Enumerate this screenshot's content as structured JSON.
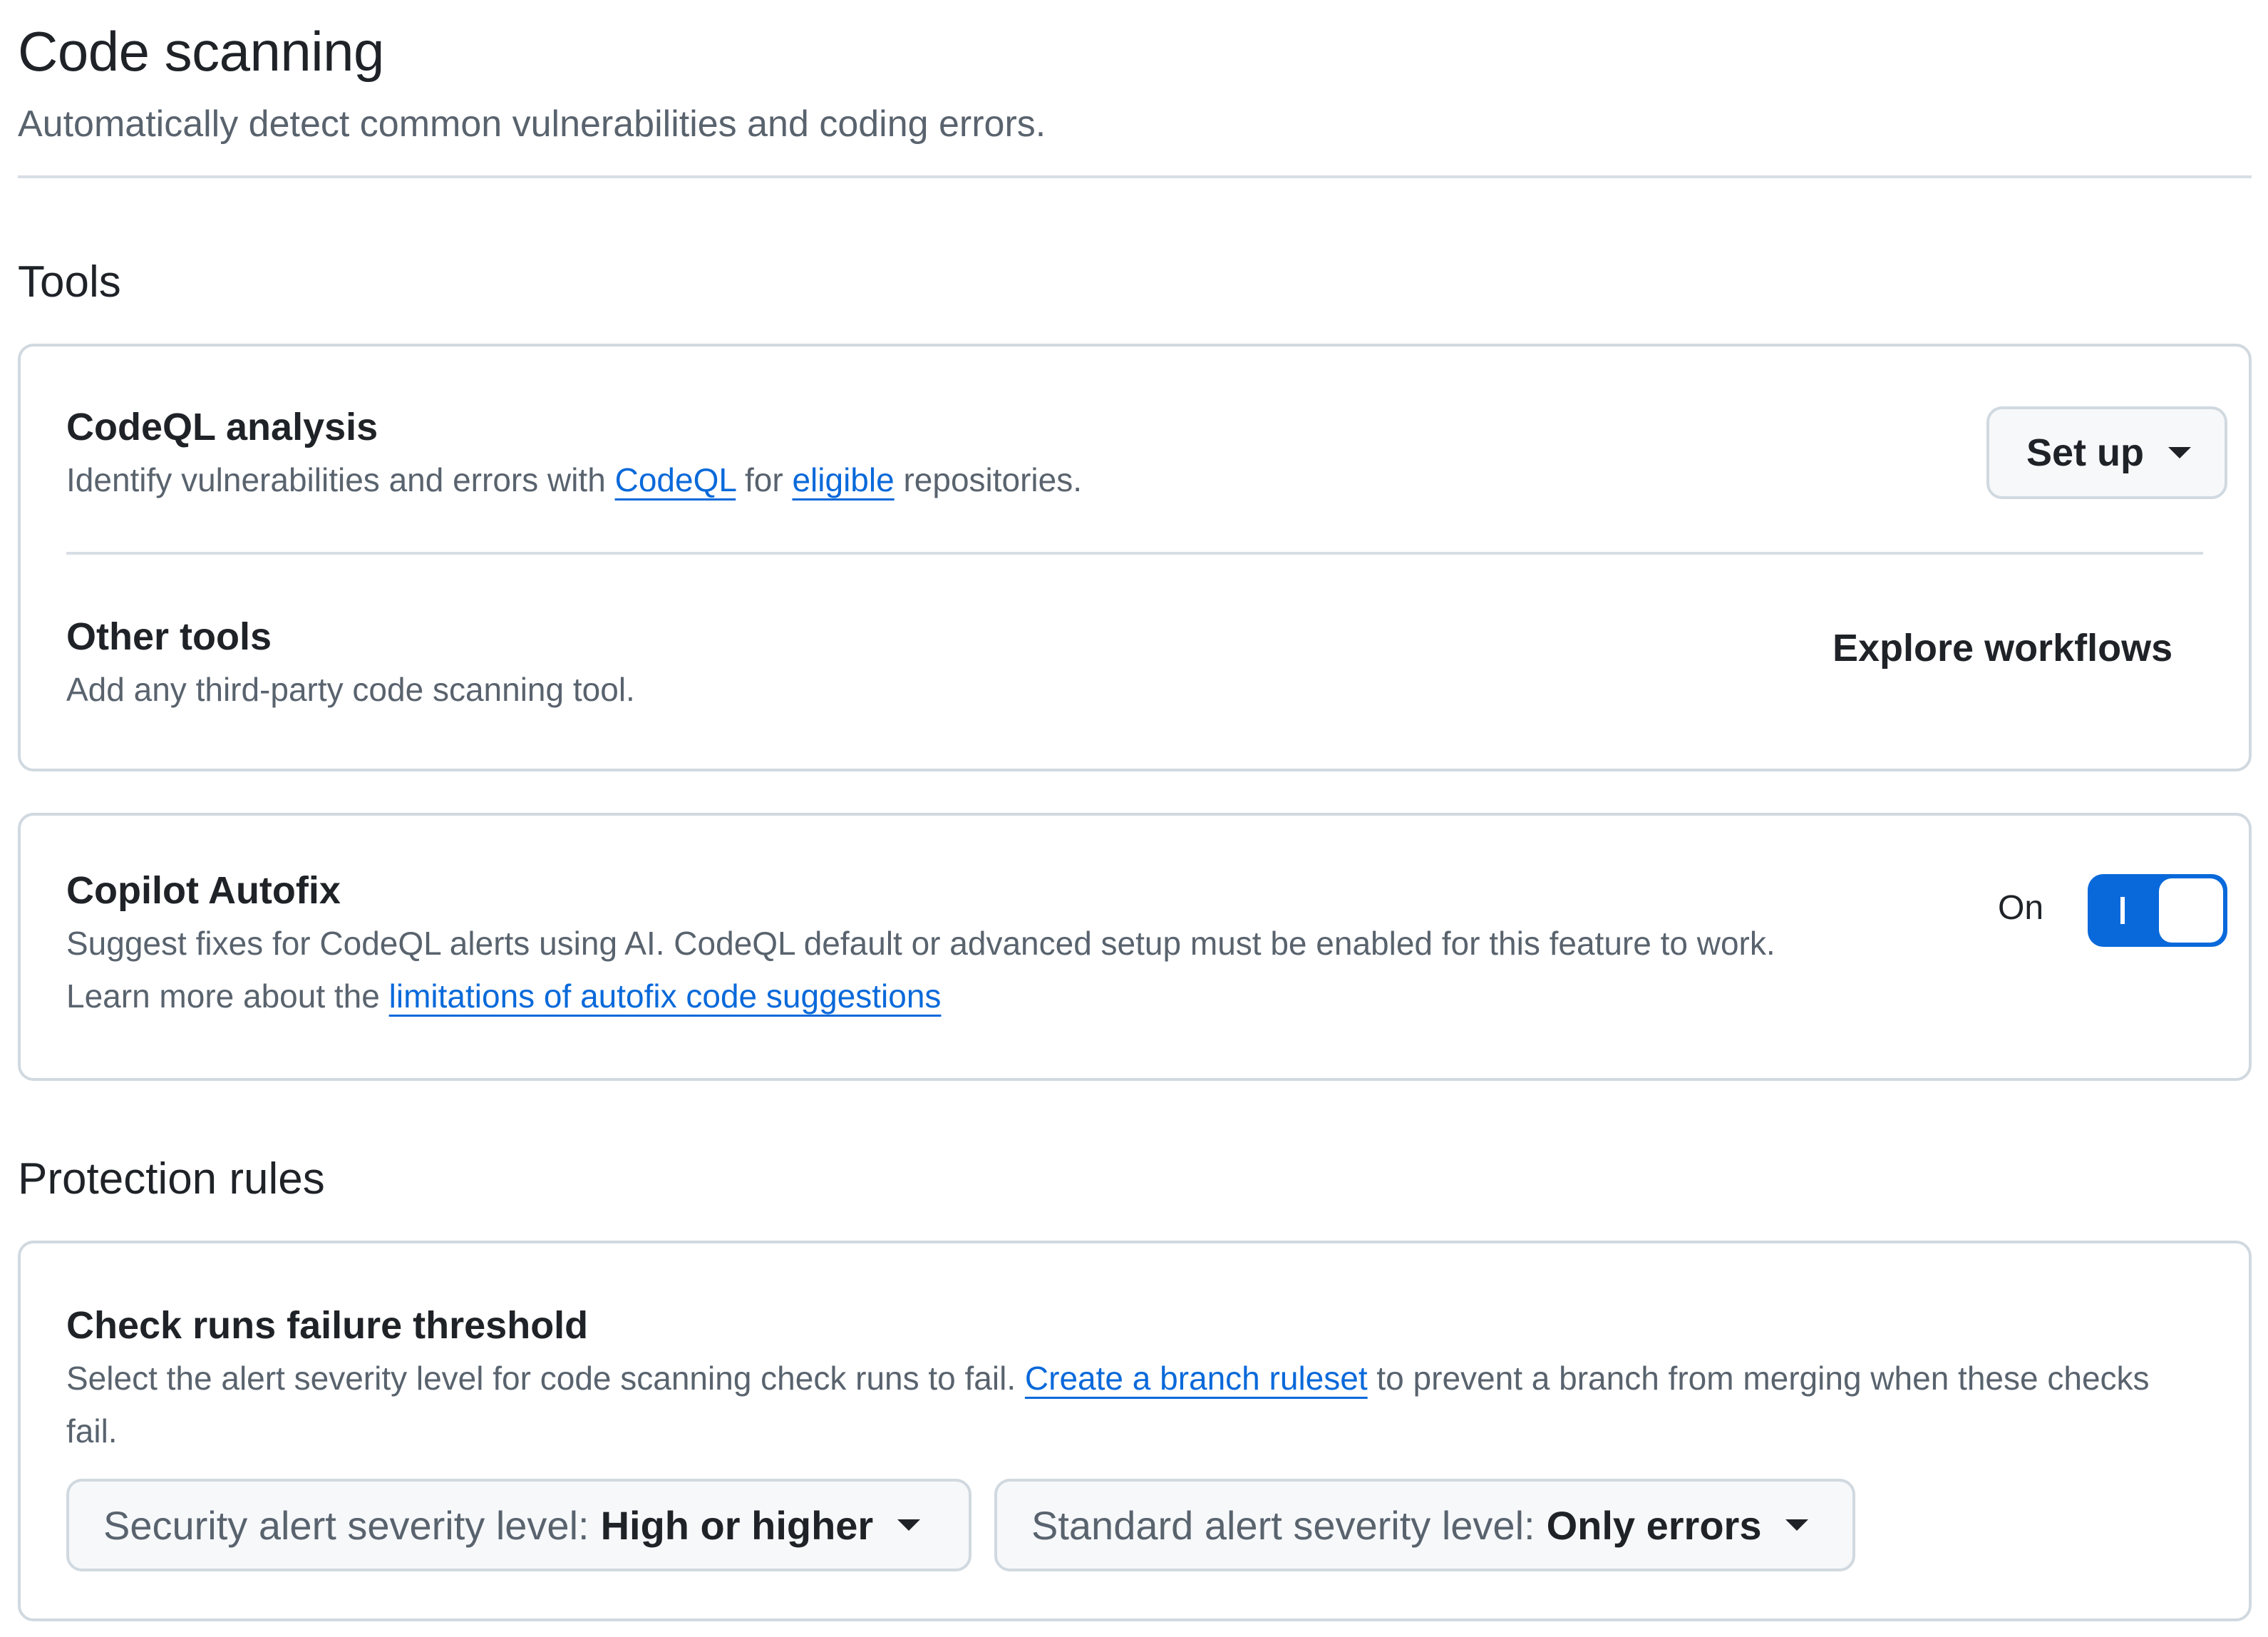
{
  "header": {
    "title": "Code scanning",
    "subtitle": "Automatically detect common vulnerabilities and coding errors."
  },
  "tools": {
    "title": "Tools",
    "codeql": {
      "title": "CodeQL analysis",
      "desc_prefix": "Identify vulnerabilities and errors with ",
      "link_codeql": "CodeQL",
      "desc_mid": " for ",
      "link_eligible": "eligible",
      "desc_suffix": " repositories.",
      "button": "Set up"
    },
    "other": {
      "title": "Other tools",
      "desc": "Add any third-party code scanning tool.",
      "button": "Explore workflows"
    }
  },
  "autofix": {
    "title": "Copilot Autofix",
    "desc_line1": "Suggest fixes for CodeQL alerts using AI. CodeQL default or advanced setup must be enabled for this feature to work.",
    "desc_line2_prefix": "Learn more about the ",
    "link": "limitations of autofix code suggestions",
    "toggle_label": "On",
    "toggle_state": "on"
  },
  "protection": {
    "title": "Protection rules",
    "threshold": {
      "title": "Check runs failure threshold",
      "desc_prefix": "Select the alert severity level for code scanning check runs to fail. ",
      "link": "Create a branch ruleset",
      "desc_suffix": " to prevent a branch from merging when these checks fail.",
      "security_label": "Security alert severity level:",
      "security_value": "High or higher",
      "standard_label": "Standard alert severity level:",
      "standard_value": "Only errors"
    }
  },
  "colors": {
    "accent": "#0969da",
    "border": "#d1d9e0",
    "muted_text": "#59636e",
    "button_bg": "#f6f8fa"
  }
}
